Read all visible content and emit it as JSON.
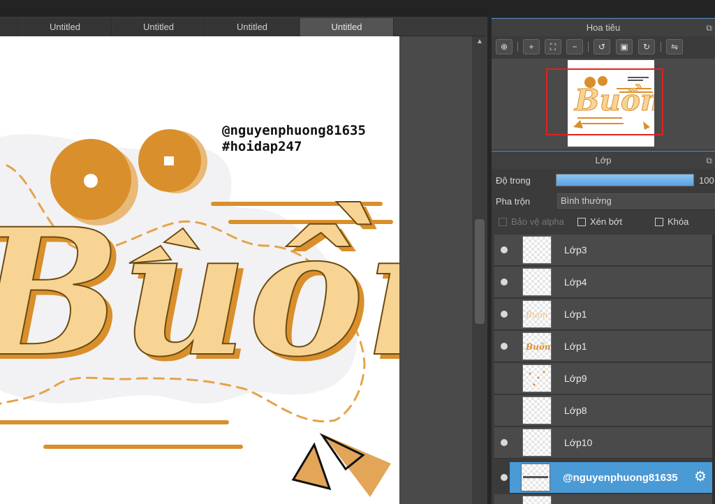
{
  "tabs": [
    {
      "label": "Untitled"
    },
    {
      "label": "Untitled"
    },
    {
      "label": "Untitled"
    },
    {
      "label": "Untitled"
    }
  ],
  "canvas": {
    "watermark_user": "@nguyenphuong81635",
    "watermark_tag": "#hoidap247",
    "art_word": "Buồn",
    "colors": {
      "orange": "#D98F2C",
      "light": "#F8D494",
      "outline": "#6B4A10",
      "halo": "#F1F1F3"
    }
  },
  "navigator": {
    "title": "Hoa tiêu",
    "tools": [
      "zoom-actual-icon",
      "zoom-in-icon",
      "fit-icon",
      "zoom-out-icon",
      "rotate-left-icon",
      "reset-rotation-icon",
      "rotate-right-icon",
      "flip-icon"
    ]
  },
  "layers_panel": {
    "title": "Lớp",
    "opacity_label": "Độ trong",
    "opacity_value": "100",
    "opacity_fraction": 1.0,
    "blend_label": "Pha trộn",
    "blend_value": "Bình thường",
    "protect_alpha": "Bảo vệ alpha",
    "clipping": "Xén bớt",
    "lock": "Khóa",
    "layers": [
      {
        "name": "Lớp3",
        "visible": true
      },
      {
        "name": "Lớp4",
        "visible": true
      },
      {
        "name": "Lớp1",
        "visible": true
      },
      {
        "name": "Lớp1",
        "visible": true
      },
      {
        "name": "Lớp9",
        "visible": false
      },
      {
        "name": "Lớp8",
        "visible": false
      },
      {
        "name": "Lớp10",
        "visible": true
      },
      {
        "name": "@nguyenphuong81635",
        "visible": true,
        "selected": true
      }
    ]
  }
}
